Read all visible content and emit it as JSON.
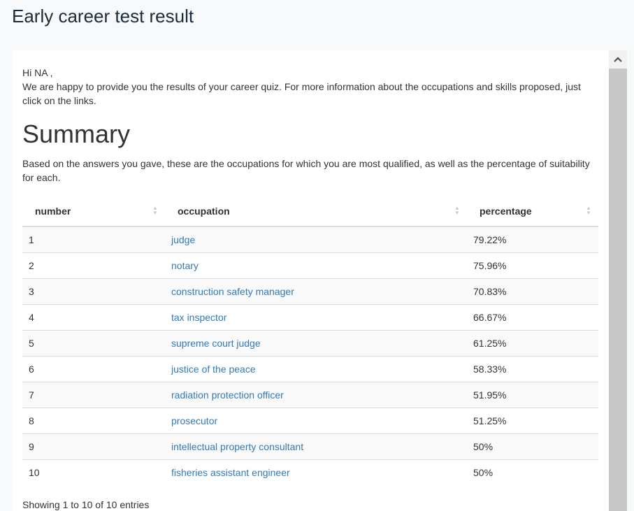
{
  "page": {
    "title": "Early career test result"
  },
  "intro": {
    "greeting": "Hi NA ,",
    "message": "We are happy to provide you the results of your career quiz. For more information about the occupations and skills proposed, just click on the links."
  },
  "summary": {
    "title": "Summary",
    "description": "Based on the answers you gave, these are the occupations for which you are most qualified, as well as the percentage of suitability for each."
  },
  "table": {
    "columns": [
      "number",
      "occupation",
      "percentage"
    ],
    "rows": [
      {
        "number": "1",
        "occupation": "judge",
        "percentage": "79.22%"
      },
      {
        "number": "2",
        "occupation": "notary",
        "percentage": "75.96%"
      },
      {
        "number": "3",
        "occupation": "construction safety manager",
        "percentage": "70.83%"
      },
      {
        "number": "4",
        "occupation": "tax inspector",
        "percentage": "66.67%"
      },
      {
        "number": "5",
        "occupation": "supreme court judge",
        "percentage": "61.25%"
      },
      {
        "number": "6",
        "occupation": "justice of the peace",
        "percentage": "58.33%"
      },
      {
        "number": "7",
        "occupation": "radiation protection officer",
        "percentage": "51.95%"
      },
      {
        "number": "8",
        "occupation": "prosecutor",
        "percentage": "51.25%"
      },
      {
        "number": "9",
        "occupation": "intellectual property consultant",
        "percentage": "50%"
      },
      {
        "number": "10",
        "occupation": "fisheries assistant engineer",
        "percentage": "50%"
      }
    ],
    "info": "Showing 1 to 10 of 10 entries"
  },
  "icons": {
    "sort": "sort-both-icon",
    "scroll_up": "chevron-up-icon"
  },
  "colors": {
    "link": "#337ab7",
    "title": "#1c2b3a"
  }
}
